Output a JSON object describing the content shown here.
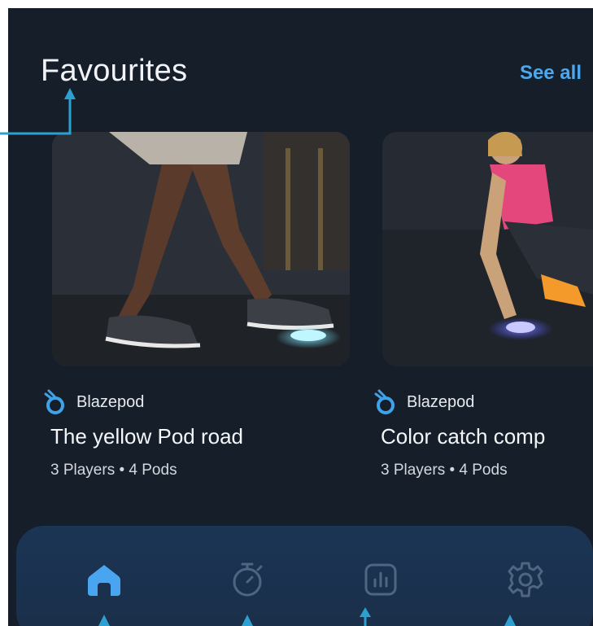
{
  "header": {
    "title": "Favourites",
    "see_all_label": "See all"
  },
  "cards": [
    {
      "brand": "Blazepod",
      "title": "The yellow Pod road",
      "meta": "3 Players • 4 Pods",
      "icon": "blazepod-logo-icon"
    },
    {
      "brand": "Blazepod",
      "title": "Color catch comp",
      "meta": "3 Players • 4 Pods",
      "icon": "blazepod-logo-icon"
    }
  ],
  "navbar": {
    "items": [
      {
        "name": "home",
        "icon": "home-icon",
        "active": true
      },
      {
        "name": "timer",
        "icon": "stopwatch-icon",
        "active": false
      },
      {
        "name": "stats",
        "icon": "bar-chart-icon",
        "active": false
      },
      {
        "name": "settings",
        "icon": "gear-icon",
        "active": false
      }
    ]
  },
  "colors": {
    "background": "#161e2a",
    "accent": "#4aa8ee",
    "navbar": "#1a3150",
    "annotation": "#2d9fd0"
  }
}
